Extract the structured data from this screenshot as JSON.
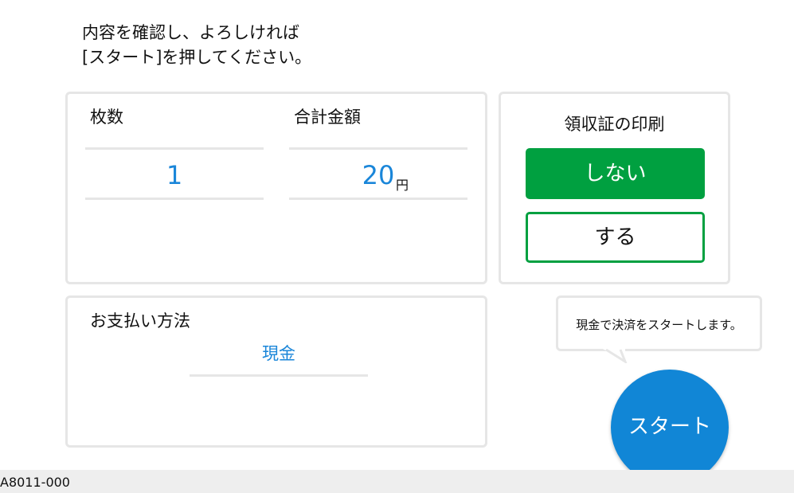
{
  "instruction": {
    "line1": "内容を確認し、よろしければ",
    "line2": "[スタート]を押してください。"
  },
  "summary": {
    "count_label": "枚数",
    "count_value": "1",
    "total_label": "合計金額",
    "total_value": "20",
    "total_unit": "円"
  },
  "receipt": {
    "title": "領収証の印刷",
    "no_label": "しない",
    "yes_label": "する",
    "selected": "しない"
  },
  "payment": {
    "label": "お支払い方法",
    "value": "現金"
  },
  "hint": {
    "text": "現金で決済をスタートします。"
  },
  "start": {
    "label": "スタート"
  },
  "footer": {
    "code": "A8011-000"
  },
  "colors": {
    "accent_blue": "#1a86d9",
    "start_blue": "#1186d6",
    "green": "#00a040",
    "panel_border": "#e6e6e6"
  }
}
